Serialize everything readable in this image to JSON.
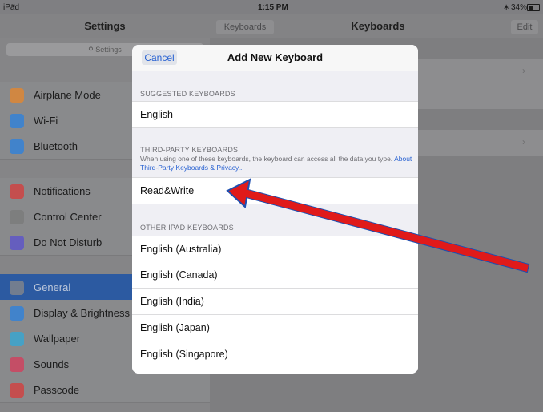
{
  "status": {
    "device": "iPad",
    "time": "1:15 PM",
    "battery": "34%"
  },
  "colors": {
    "accent": "#2a63d2",
    "selected": "#2c5aa1",
    "arrow": "#e01a1a"
  },
  "sidebar": {
    "title": "Settings",
    "search_placeholder": "Settings",
    "items": [
      {
        "label": "Airplane Mode",
        "icon": "airplane-icon",
        "color": "#e8862a"
      },
      {
        "label": "Wi-Fi",
        "icon": "wifi-icon",
        "color": "#2a80e0"
      },
      {
        "label": "Bluetooth",
        "icon": "bluetooth-icon",
        "color": "#2a80e0"
      },
      {
        "label": "Notifications",
        "icon": "notifications-icon",
        "color": "#d83a3a"
      },
      {
        "label": "Control Center",
        "icon": "control-center-icon",
        "color": "#7a7a7a"
      },
      {
        "label": "Do Not Disturb",
        "icon": "moon-icon",
        "color": "#5a4fcf"
      },
      {
        "label": "General",
        "icon": "gear-icon",
        "color": "#8a8a8a"
      },
      {
        "label": "Display & Brightness",
        "icon": "display-icon",
        "color": "#2a80e0"
      },
      {
        "label": "Wallpaper",
        "icon": "wallpaper-icon",
        "color": "#30a8d8"
      },
      {
        "label": "Sounds",
        "icon": "sound-icon",
        "color": "#d83a5a"
      },
      {
        "label": "Passcode",
        "icon": "lock-icon",
        "color": "#d83a3a"
      }
    ]
  },
  "nav": {
    "back": "Keyboards",
    "title": "Keyboards",
    "edit": "Edit"
  },
  "modal": {
    "cancel": "Cancel",
    "title": "Add New Keyboard",
    "suggested_header": "SUGGESTED KEYBOARDS",
    "suggested": [
      "English"
    ],
    "third_party_header": "THIRD-PARTY KEYBOARDS",
    "third_party_note": "When using one of these keyboards, the keyboard can access all the data you type.",
    "third_party_link": "About Third-Party Keyboards & Privacy...",
    "third_party": [
      "Read&Write"
    ],
    "other_header": "OTHER IPAD KEYBOARDS",
    "other": [
      "English (Australia)",
      "English (Canada)",
      "English (India)",
      "English (Japan)",
      "English (Singapore)"
    ]
  }
}
